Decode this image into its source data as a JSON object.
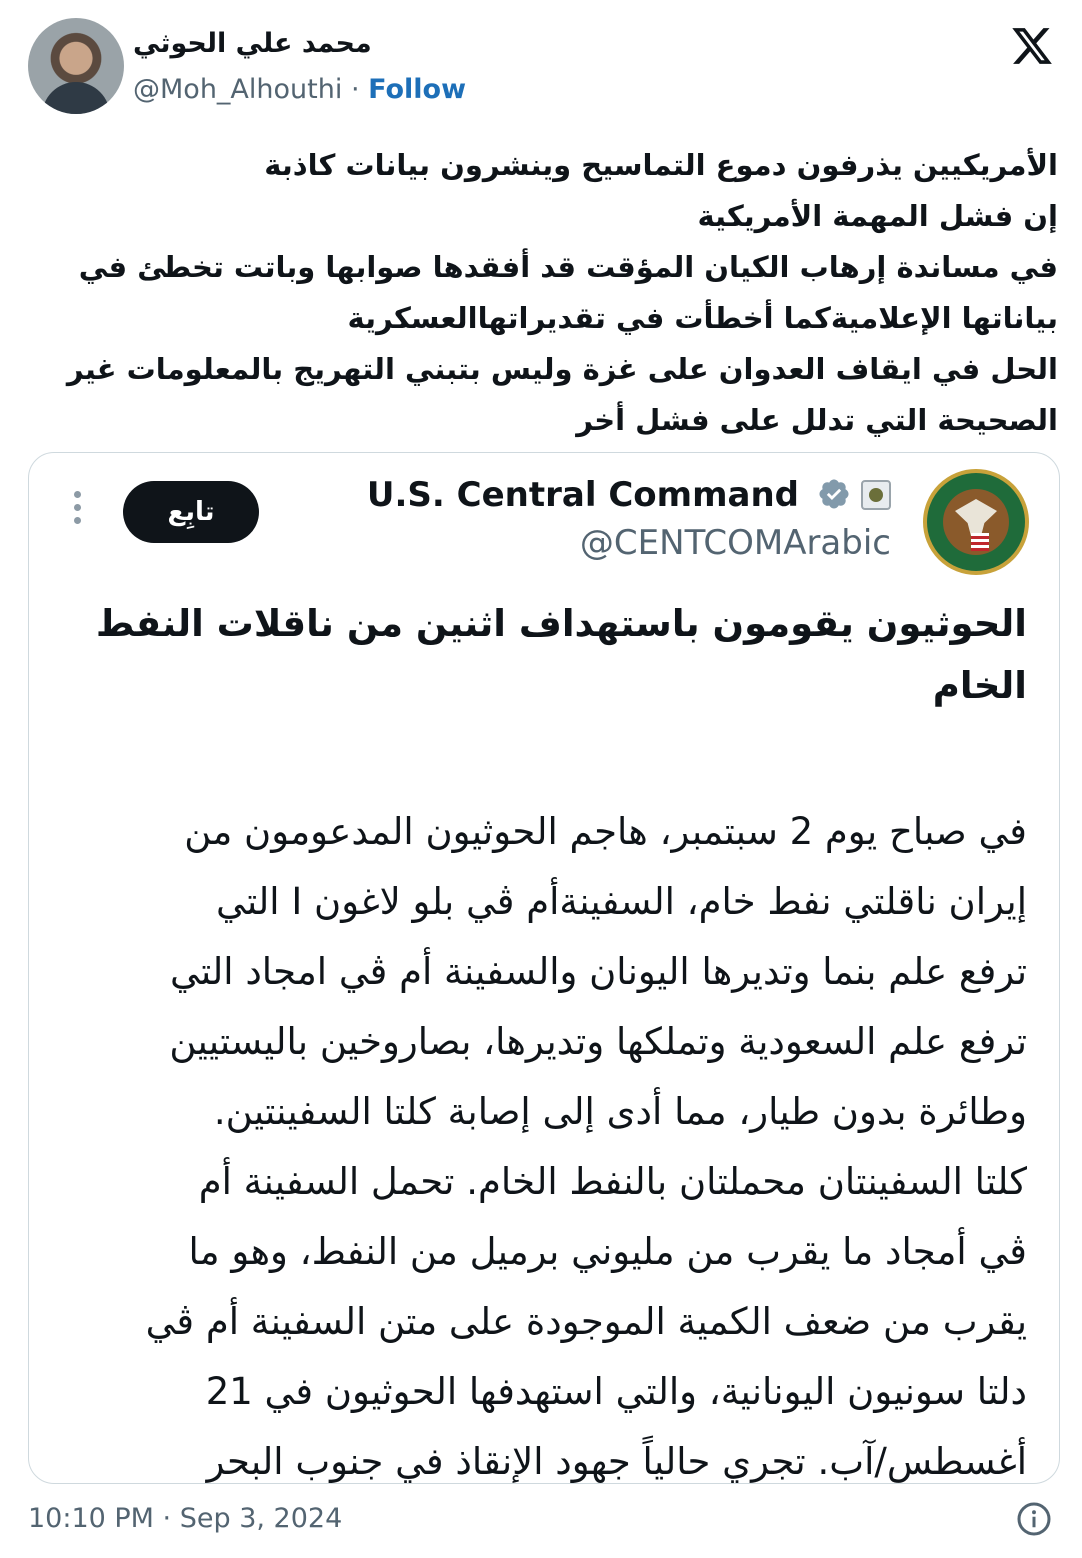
{
  "author": {
    "display_name": "محمد علي الحوثي",
    "handle": "@Moh_Alhouthi",
    "separator": "·",
    "follow_label": "Follow"
  },
  "tweet": {
    "lines": [
      "الأمريكيين يذرفون دموع التماسيح وينشرون بيانات كاذبة",
      "إن فشل المهمة الأمريكية",
      "في مساندة إرهاب الكيان المؤقت قد أفقدها صوابها وباتت تخطئ في",
      "بياناتها الإعلاميةكما أخطأت في تقديراتهاالعسكرية",
      "الحل في ايقاف العدوان على غزة وليس بتبني التهريج بالمعلومات غير",
      "الصحيحة التي تدلل على فشل أخر"
    ]
  },
  "quoted": {
    "name": "U.S. Central Command",
    "handle": "@CENTCOMArabic",
    "follow_label": "تابِع",
    "title_lines": [
      "الحوثيون يقومون باستهداف اثنين من ناقلات النفط",
      "الخام"
    ],
    "body_lines": [
      "في صباح يوم 2 سبتمبر، هاجم الحوثيون المدعومون من",
      "إيران ناقلتي نفط خام، السفينةأم ڤي بلو لاغون I التي",
      "ترفع علم بنما وتديرها اليونان والسفينة أم ڤي امجاد التي",
      "ترفع علم السعودية وتملكها وتديرها، بصاروخين باليستيين",
      "وطائرة بدون طيار، مما أدى إلى إصابة كلتا السفينتين.",
      "كلتا السفينتان محملتان بالنفط الخام. تحمل السفينة أم",
      "ڤي أمجاد ما يقرب من مليوني برميل من النفط، وهو ما",
      "يقرب من ضعف الكمية الموجودة على متن السفينة أم ڤي",
      "دلتا سونيون اليونانية، والتي استهدفها الحوثيون في 21",
      "أغسطس/آب. تجري حالياً جهود الإنقاذ في جنوب البحر"
    ]
  },
  "footer": {
    "timestamp": "10:10 PM · Sep 3, 2024"
  },
  "icons": {
    "brand": "x-logo-icon",
    "verified": "verified-badge-icon",
    "affiliation": "centcom-affiliate-icon",
    "more": "more-options-icon",
    "info": "info-icon"
  },
  "colors": {
    "link": "#1d6fb8",
    "verified": "#829aab",
    "button_bg": "#0f1419",
    "secondary_text": "#536471",
    "border": "#cfd9de"
  }
}
